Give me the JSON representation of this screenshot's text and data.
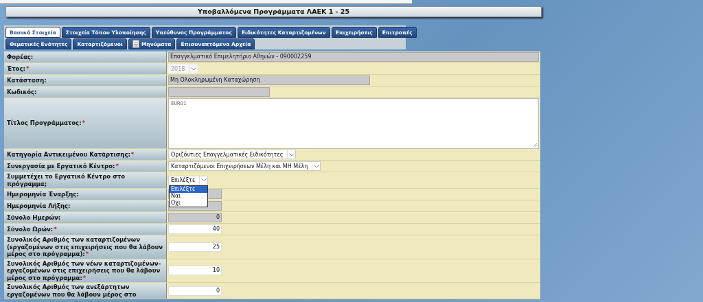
{
  "title": "Υποβαλλόμενα Προγράμματα ΛΑΕΚ 1 - 25",
  "tab_rows": [
    [
      {
        "label": "Βασικά Στοιχεία",
        "selected": true,
        "kind": "plain"
      },
      {
        "label": "Στοιχεία Τόπου Υλοποίησης",
        "selected": false,
        "kind": "plain"
      },
      {
        "label": "Υπεύθυνος Προγράμματος",
        "selected": false,
        "kind": "plain"
      },
      {
        "label": "Ειδικότητες Καταρτιζομένων",
        "selected": false,
        "kind": "plain"
      },
      {
        "label": "Επιχειρήσεις",
        "selected": false,
        "kind": "plain"
      },
      {
        "label": "Επιτροπές",
        "selected": false,
        "kind": "plain"
      }
    ],
    [
      {
        "label": "Θεματικές Ενότητες",
        "selected": false,
        "kind": "plain"
      },
      {
        "label": "Καταρτιζόμενοι",
        "selected": false,
        "kind": "plain"
      },
      {
        "label": "Μηνύματα",
        "selected": false,
        "kind": "note"
      },
      {
        "label": "Επισυναπτόμενα Αρχεία",
        "selected": false,
        "kind": "plain"
      }
    ]
  ],
  "fields": [
    {
      "label": "Φορέας:",
      "kind": "wide",
      "value": "Επαγγελματικό Επιμελητήριο Αθηνών - 090002259"
    },
    {
      "label": "Έτος:",
      "mark": "*",
      "kind": "select",
      "disabled": true,
      "value": "2018"
    },
    {
      "label": "Κατάσταση:",
      "kind": "status",
      "value": "Μη Ολοκληρωμένη Καταχώρηση"
    },
    {
      "label": "Κωδικός:",
      "kind": "code"
    },
    {
      "label": "Τίτλος Προγράμματος:",
      "mark": "*",
      "kind": "textarea",
      "value": "EURO1"
    },
    {
      "label": "Κατηγορία Αντικειμένου Κατάρτισης:",
      "mark": "*",
      "kind": "select",
      "disabled": false,
      "value": "Οριζόντιες Επαγγελματικές Ειδικότητες"
    },
    {
      "label": "Συνεργασία με Εργατικό Κέντρο:",
      "mark": "*",
      "kind": "select",
      "disabled": false,
      "value": "Καταρτιζόμενοι Επιχειρήσεων Μέλη και ΜΗ Μέλη"
    },
    {
      "label": "Συμμετέχει το Εργατικό Κέντρο στο πρόγραμμα;",
      "kind": "select",
      "disabled": false,
      "value": "Επιλέξτε",
      "expanded": true,
      "options": [
        {
          "label": "Επιλέξτε",
          "selected": true
        },
        {
          "label": "Ναι",
          "selected": false
        },
        {
          "label": "Οχι",
          "selected": false
        }
      ]
    },
    {
      "label": "Ημερομηνία Έναρξης:",
      "kind": "date"
    },
    {
      "label": "Ημερομηνία Λήξης:",
      "kind": "date"
    },
    {
      "label": "Σύνολο Ημερών:",
      "kind": "total",
      "value": "0"
    },
    {
      "label": "Σύνολο Ωρών:",
      "mark": "*",
      "kind": "number",
      "value": "40"
    },
    {
      "label": "Συνολικός Αριθμός των καταρτιζομένων (εργαζομένων στις επιχειρήσεις που θα λάβουν μέρος στο πρόγραμμα):",
      "mark": "*",
      "kind": "number",
      "value": "25"
    },
    {
      "label": "Συνολικός Αριθμός των νέων καταρτιζομένων-εργαζομένων στις επιχειρήσεις που θα λάβουν μέρος στο πρόγραμμα:",
      "mark": "*",
      "kind": "number",
      "value": "10"
    },
    {
      "label": "Συνολικός Αριθμός των ανεξάρτητων εργαζομένων που θα λάβουν μέρος στο",
      "kind": "number",
      "value": "0"
    }
  ]
}
